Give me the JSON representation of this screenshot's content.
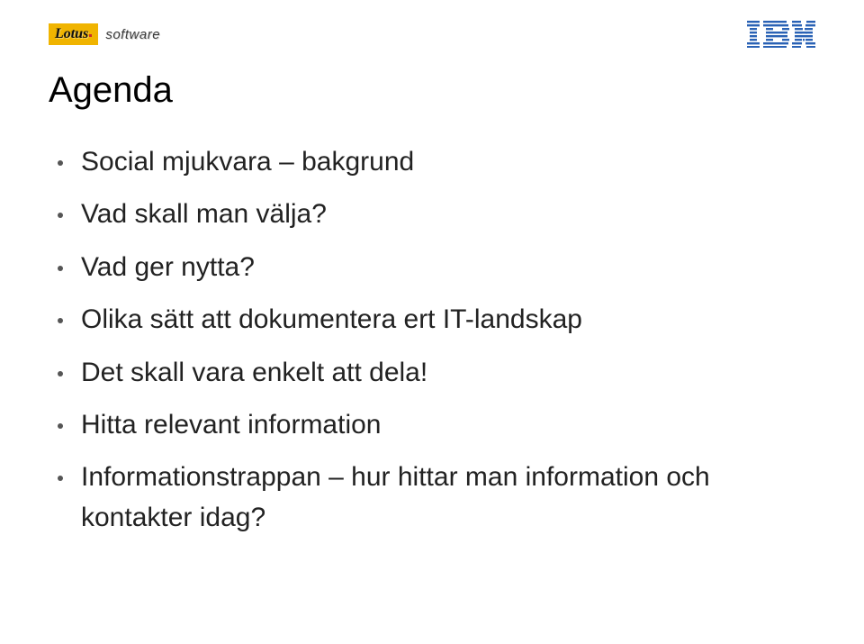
{
  "brand": {
    "lotus": "Lotus",
    "software": "software",
    "lotus_color": "#f0b400",
    "ibm_color": "#2a62b5"
  },
  "title": "Agenda",
  "bullets": [
    "Social mjukvara – bakgrund",
    "Vad skall man välja?",
    "Vad ger nytta?",
    "Olika sätt att dokumentera ert IT-landskap",
    "Det skall vara enkelt att dela!",
    "Hitta relevant information",
    "Informationstrappan – hur hittar man information och kontakter idag?"
  ]
}
